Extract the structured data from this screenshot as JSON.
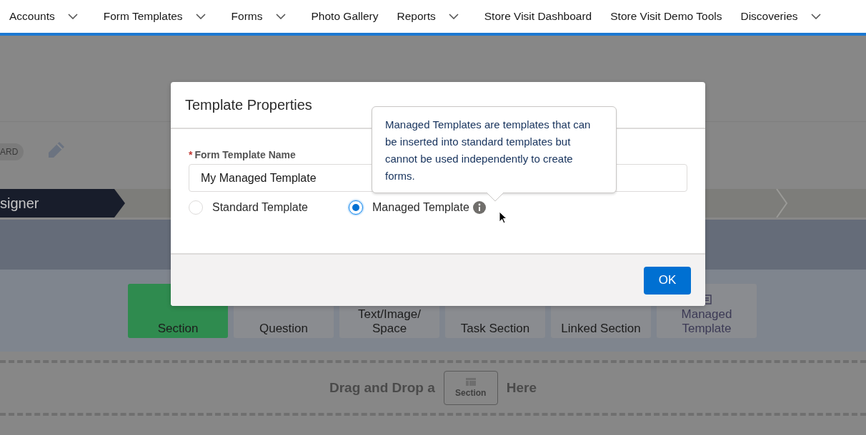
{
  "nav": [
    {
      "label": "Accounts",
      "dropdown": true
    },
    {
      "label": "Form Templates",
      "dropdown": true
    },
    {
      "label": "Forms",
      "dropdown": true
    },
    {
      "label": "Photo Gallery",
      "dropdown": false
    },
    {
      "label": "Reports",
      "dropdown": true
    },
    {
      "label": "Store Visit Dashboard",
      "dropdown": false
    },
    {
      "label": "Store Visit Demo Tools",
      "dropdown": false
    },
    {
      "label": "Discoveries",
      "dropdown": true
    }
  ],
  "record": {
    "badge": "ARD"
  },
  "path": {
    "current_step": "signer"
  },
  "palette": [
    {
      "label": "Section",
      "highlighted": true,
      "kind": "standard"
    },
    {
      "label": "Question",
      "highlighted": false,
      "kind": "standard"
    },
    {
      "label": "Text/Image/ Space",
      "highlighted": false,
      "kind": "standard"
    },
    {
      "label": "Task Section",
      "highlighted": false,
      "kind": "standard"
    },
    {
      "label": "Linked Section",
      "highlighted": false,
      "kind": "standard"
    },
    {
      "label": "Managed Template",
      "highlighted": false,
      "kind": "managed"
    }
  ],
  "drop_zone": {
    "before": "Drag and Drop a",
    "chip": "Section",
    "after": "Here"
  },
  "dialog": {
    "title": "Template Properties",
    "field_label": "Form Template Name",
    "required_mark": "*",
    "field_value": "My Managed Template",
    "options": [
      {
        "label": "Standard Template",
        "selected": false,
        "info": false
      },
      {
        "label": "Managed Template",
        "selected": true,
        "info": true
      }
    ],
    "tooltip": "Managed Templates are templates that can be inserted into standard templates but cannot be used independently to create forms.",
    "ok": "OK"
  }
}
